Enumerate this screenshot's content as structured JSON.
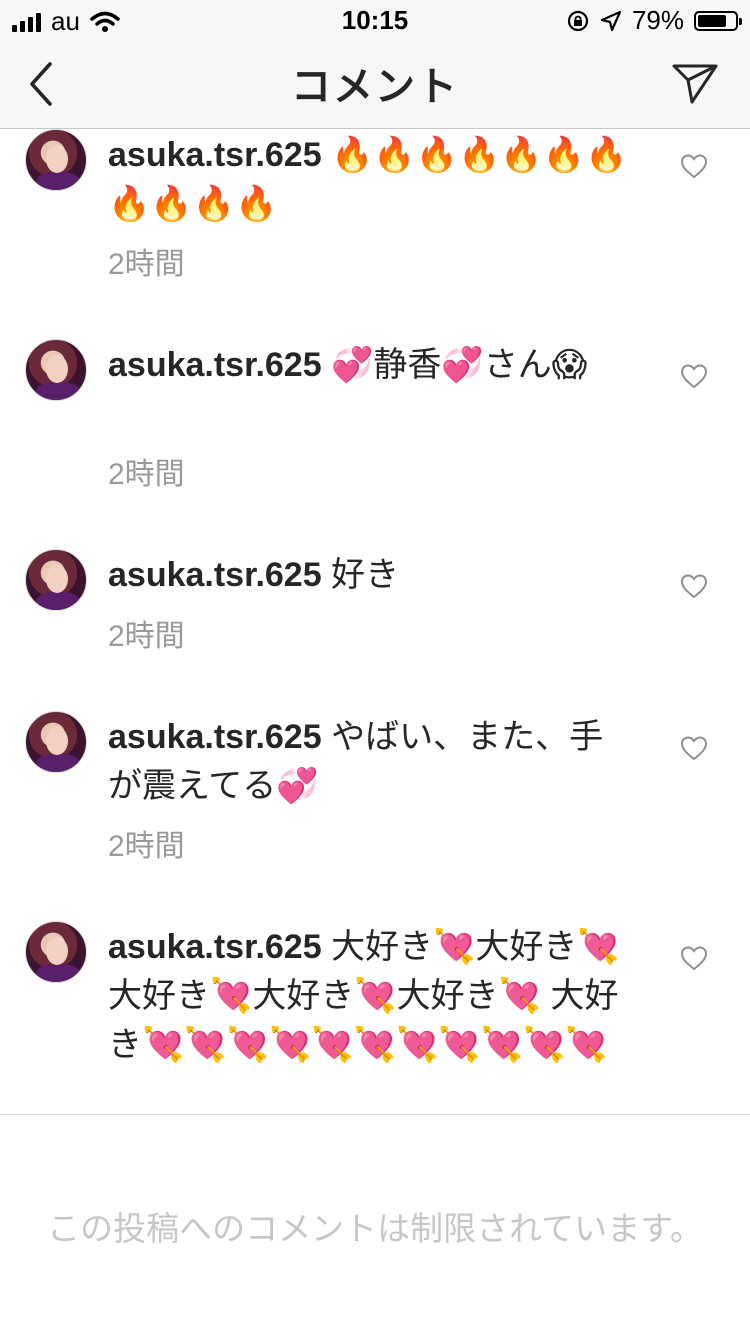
{
  "status_bar": {
    "carrier": "au",
    "time": "10:15",
    "battery_percent": "79%",
    "battery_level": 0.79,
    "icons": [
      "signal-icon",
      "wifi-icon",
      "rotation-lock-icon",
      "location-icon",
      "battery-icon"
    ]
  },
  "header": {
    "title": "コメント",
    "back_icon": "chevron-left-icon",
    "send_icon": "paper-plane-icon"
  },
  "comments": [
    {
      "username": "asuka.tsr.625",
      "text": "🔥🔥🔥🔥🔥🔥🔥🔥🔥🔥🔥",
      "time": "2時間"
    },
    {
      "username": "asuka.tsr.625",
      "text": "💞静香💞さん😱",
      "time": "2時間"
    },
    {
      "username": "asuka.tsr.625",
      "text": "好き",
      "time": "2時間"
    },
    {
      "username": "asuka.tsr.625",
      "text": "やばい、また、手が震えてる💞",
      "time": "2時間"
    },
    {
      "username": "asuka.tsr.625",
      "text": "大好き💘大好き💘大好き💘大好き💘大好き💘 大好き💘💘💘💘💘💘💘💘💘💘💘",
      "time": ""
    }
  ],
  "footer": {
    "restricted_text": "この投稿へのコメントは制限されています。"
  }
}
